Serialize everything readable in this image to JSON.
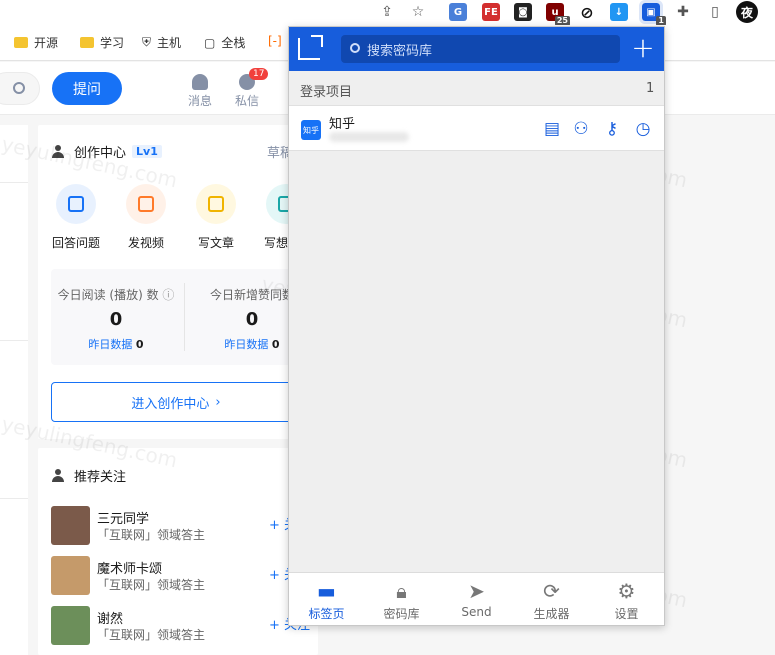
{
  "browser": {
    "bookmarks": [
      {
        "label": "开源"
      },
      {
        "label": "学习"
      },
      {
        "label": "主机"
      },
      {
        "label": "全栈"
      }
    ],
    "extensions": [
      {
        "name": "translate-ext",
        "color": "#4a80d9"
      },
      {
        "name": "fe-ext",
        "label": "FE",
        "color": "#d32f2f"
      },
      {
        "name": "robot-ext",
        "color": "#222222"
      },
      {
        "name": "ublock-ext",
        "badge": "25",
        "color": "#800000"
      },
      {
        "name": "block-ext",
        "color": "#111111"
      },
      {
        "name": "download-ext",
        "color": "#2196f3"
      },
      {
        "name": "bitwarden-ext",
        "badge": "1",
        "color": "#175ddc"
      }
    ],
    "night_label": "夜"
  },
  "zhihu": {
    "ask_label": "提问",
    "nav": [
      {
        "label": "消息"
      },
      {
        "label": "私信",
        "badge": "17"
      }
    ],
    "creator": {
      "title": "创作中心",
      "level": "Lv1",
      "drafts": "草稿",
      "tools": [
        {
          "label": "回答问题",
          "color": "#1772f6",
          "bg": "#e8f1fe"
        },
        {
          "label": "发视频",
          "color": "#ff7a2a",
          "bg": "#fff1e8"
        },
        {
          "label": "写文章",
          "color": "#f0b400",
          "bg": "#fff8e0"
        },
        {
          "label": "写想",
          "color": "#1aa7a7",
          "bg": "#e4f7f7"
        }
      ],
      "stats": [
        {
          "label": "今日阅读 (播放) 数",
          "value": "0",
          "sub_label": "昨日数据",
          "sub_value": "0"
        },
        {
          "label": "今日新增赞同数",
          "value": "0",
          "sub_label": "昨日数据",
          "sub_value": "0"
        }
      ],
      "enter_label": "进入创作中心"
    },
    "follow": {
      "title": "推荐关注",
      "users": [
        {
          "name": "三元同学",
          "desc": "「互联网」领域答主",
          "follow": "+ 关注",
          "color": "#7b5a4a"
        },
        {
          "name": "魔术师卡颂",
          "desc": "「互联网」领域答主",
          "follow": "+ 关注",
          "color": "#c59a6a"
        },
        {
          "name": "谢然",
          "desc": "「互联网」领域答主",
          "follow": "+ 关注",
          "color": "#6c8f5a"
        }
      ]
    }
  },
  "vault": {
    "search_placeholder": "搜索密码库",
    "section_label": "登录项目",
    "section_count": "1",
    "items": [
      {
        "name": "知乎",
        "logo_text": "知乎"
      }
    ],
    "nav": [
      {
        "label": "标签页",
        "icon": "folder-icon",
        "active": true
      },
      {
        "label": "密码库",
        "icon": "lock-icon",
        "active": false
      },
      {
        "label": "Send",
        "icon": "send-icon",
        "active": false
      },
      {
        "label": "生成器",
        "icon": "refresh-icon",
        "active": false
      },
      {
        "label": "设置",
        "icon": "gear-icon",
        "active": false
      }
    ]
  },
  "watermark": "yeyulingfeng.com"
}
